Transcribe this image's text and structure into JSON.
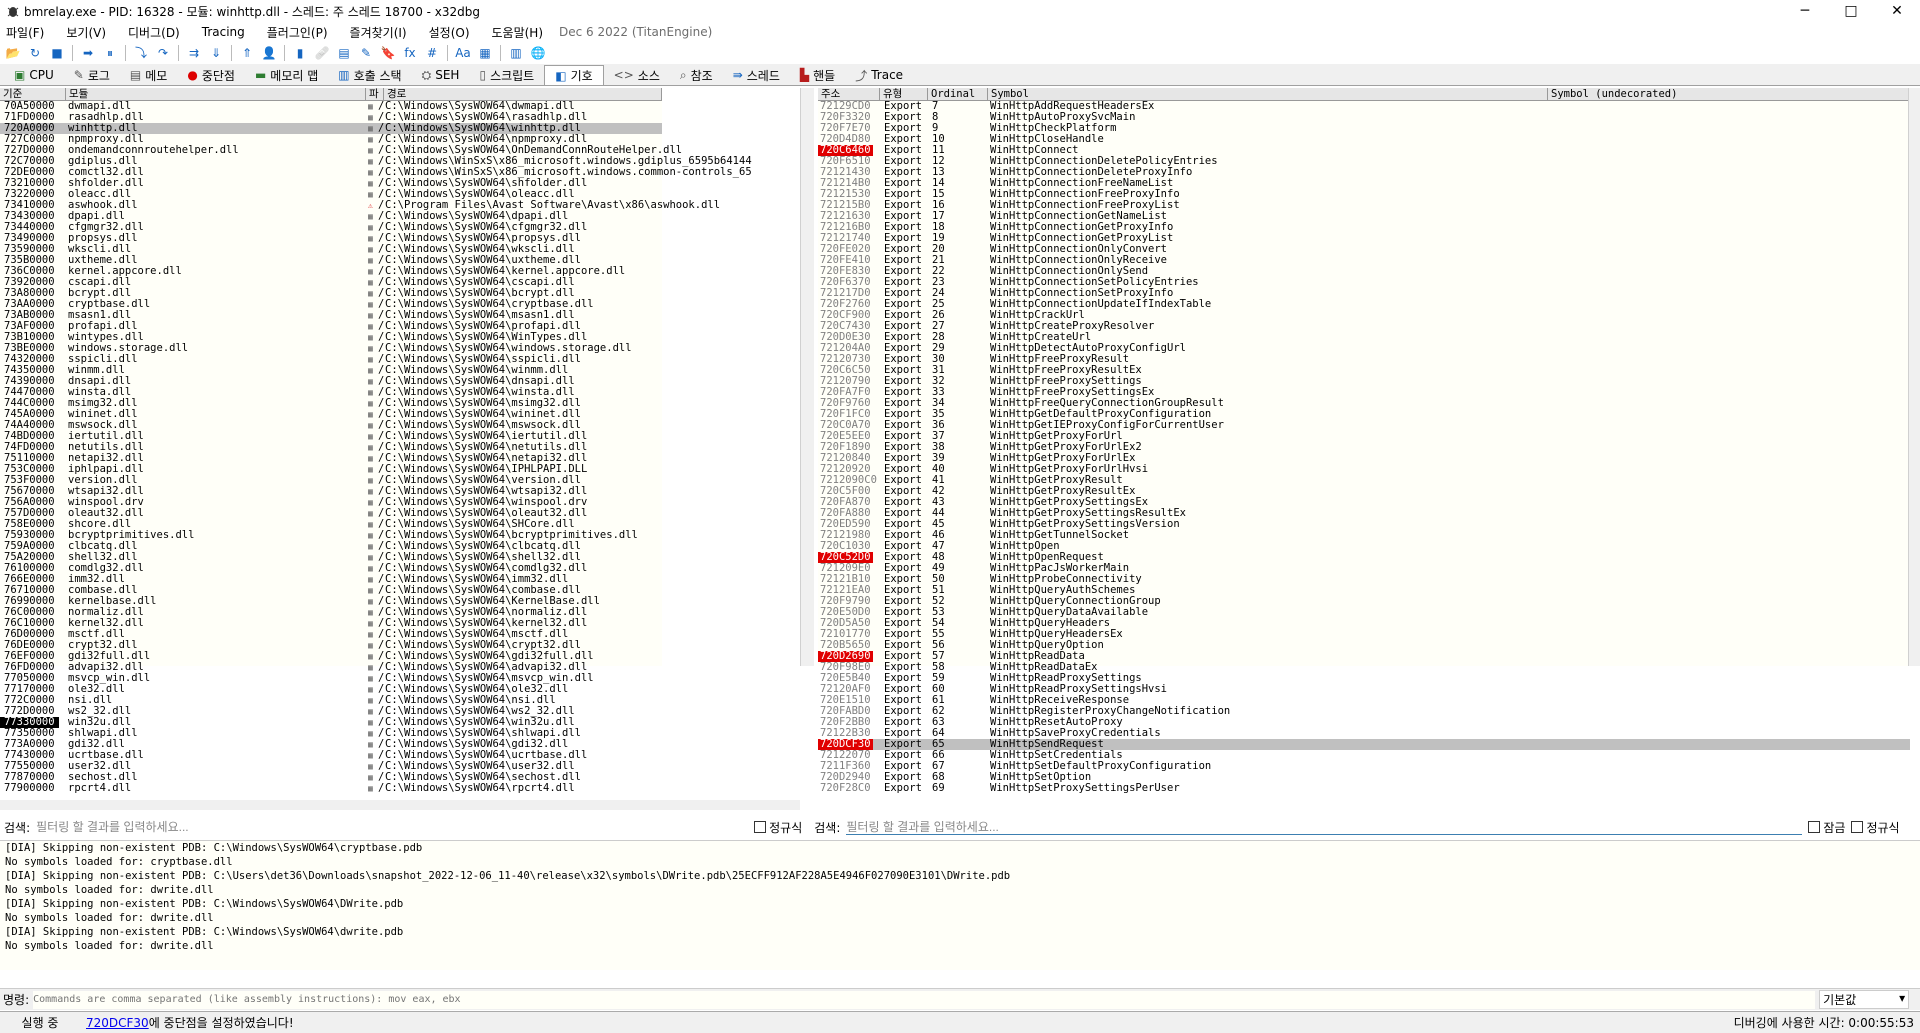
{
  "window": {
    "title": "bmrelay.exe - PID: 16328 - 모듈: winhttp.dll - 스레드: 주 스레드 18700 - x32dbg",
    "minimize": "─",
    "maximize": "□",
    "close": "✕"
  },
  "menu": {
    "items": [
      "파일(F)",
      "보기(V)",
      "디버그(D)",
      "Tracing",
      "플러그인(P)",
      "즐겨찾기(I)",
      "설정(O)",
      "도움말(H)"
    ],
    "build_date": "Dec 6 2022 (TitanEngine)"
  },
  "toolbar": {
    "icons": [
      {
        "name": "open-icon",
        "glyph": "📂"
      },
      {
        "name": "restart-icon",
        "glyph": "↻"
      },
      {
        "name": "close-icon",
        "glyph": "■"
      },
      {
        "sep": true
      },
      {
        "name": "run-icon",
        "glyph": "➡"
      },
      {
        "name": "pause-icon",
        "glyph": "⏸"
      },
      {
        "sep": true
      },
      {
        "name": "step-into-icon",
        "glyph": "⤵"
      },
      {
        "name": "step-over-icon",
        "glyph": "↷"
      },
      {
        "sep": true
      },
      {
        "name": "trace-into-icon",
        "glyph": "⇉"
      },
      {
        "name": "trace-over-icon",
        "glyph": "⇓"
      },
      {
        "sep": true
      },
      {
        "name": "execute-till-return-icon",
        "glyph": "⇑"
      },
      {
        "name": "run-to-user-icon",
        "glyph": "👤"
      },
      {
        "sep": true
      },
      {
        "name": "scylla-icon",
        "glyph": "▮"
      },
      {
        "name": "patch-icon",
        "glyph": "🩹"
      },
      {
        "name": "comments-icon",
        "glyph": "▤"
      },
      {
        "name": "labels-icon",
        "glyph": "✎"
      },
      {
        "name": "bookmarks-icon",
        "glyph": "🔖"
      },
      {
        "name": "functions-icon",
        "glyph": "fx"
      },
      {
        "name": "hash-icon",
        "glyph": "#"
      },
      {
        "sep": true
      },
      {
        "name": "font-icon",
        "glyph": "Aa"
      },
      {
        "name": "calculator-icon",
        "glyph": "▦"
      },
      {
        "sep": true
      },
      {
        "name": "notes-icon",
        "glyph": "▥"
      },
      {
        "name": "globe-icon",
        "glyph": "🌐"
      }
    ]
  },
  "tabs": [
    {
      "label": "CPU",
      "icon": "cpu-icon",
      "glyph": "▣",
      "color": "#2e7d32",
      "active": false
    },
    {
      "label": "로그",
      "icon": "log-icon",
      "glyph": "✎",
      "color": "#555",
      "active": false
    },
    {
      "label": "메모",
      "icon": "notes-icon",
      "glyph": "▤",
      "color": "#555",
      "active": false
    },
    {
      "label": "중단점",
      "icon": "breakpoint-icon",
      "glyph": "●",
      "color": "#d00",
      "active": false
    },
    {
      "label": "메모리 맵",
      "icon": "memory-map-icon",
      "glyph": "▬",
      "color": "#2e7d32",
      "active": false
    },
    {
      "label": "호출 스택",
      "icon": "call-stack-icon",
      "glyph": "▥",
      "color": "#1565c0",
      "active": false
    },
    {
      "label": "SEH",
      "icon": "seh-icon",
      "glyph": "⛭",
      "color": "#555",
      "active": false
    },
    {
      "label": "스크립트",
      "icon": "script-icon",
      "glyph": "▯",
      "color": "#555",
      "active": false
    },
    {
      "label": "기호",
      "icon": "symbols-icon",
      "glyph": "◧",
      "color": "#1565c0",
      "active": true
    },
    {
      "label": "소스",
      "icon": "source-icon",
      "glyph": "<>",
      "color": "#555",
      "active": false
    },
    {
      "label": "참조",
      "icon": "references-icon",
      "glyph": "⌕",
      "color": "#555",
      "active": false
    },
    {
      "label": "스레드",
      "icon": "threads-icon",
      "glyph": "⇛",
      "color": "#1565c0",
      "active": false
    },
    {
      "label": "핸들",
      "icon": "handles-icon",
      "glyph": "▙",
      "color": "#b71c1c",
      "active": false
    },
    {
      "label": "Trace",
      "icon": "trace-icon",
      "glyph": "⤴",
      "color": "#555",
      "active": false
    }
  ],
  "modules": {
    "headers": [
      "기준",
      "모듈",
      "파",
      "경로"
    ],
    "rows": [
      [
        "70A50000",
        "dwmapi.dll",
        "C:\\Windows\\SysWOW64\\dwmapi.dll"
      ],
      [
        "71FD0000",
        "rasadhlp.dll",
        "C:\\Windows\\SysWOW64\\rasadhlp.dll"
      ],
      [
        "720A0000",
        "winhttp.dll",
        "C:\\Windows\\SysWOW64\\winhttp.dll"
      ],
      [
        "727C0000",
        "npmproxy.dll",
        "C:\\Windows\\SysWOW64\\npmproxy.dll"
      ],
      [
        "727D0000",
        "ondemandconnroutehelper.dll",
        "C:\\Windows\\SysWOW64\\OnDemandConnRouteHelper.dll"
      ],
      [
        "72C70000",
        "gdiplus.dll",
        "C:\\Windows\\WinSxS\\x86_microsoft.windows.gdiplus_6595b64144"
      ],
      [
        "72DE0000",
        "comctl32.dll",
        "C:\\Windows\\WinSxS\\x86_microsoft.windows.common-controls_65"
      ],
      [
        "73210000",
        "shfolder.dll",
        "C:\\Windows\\SysWOW64\\shfolder.dll"
      ],
      [
        "73220000",
        "oleacc.dll",
        "C:\\Windows\\SysWOW64\\oleacc.dll"
      ],
      [
        "73410000",
        "aswhook.dll",
        "C:\\Program Files\\Avast Software\\Avast\\x86\\aswhook.dll"
      ],
      [
        "73430000",
        "dpapi.dll",
        "C:\\Windows\\SysWOW64\\dpapi.dll"
      ],
      [
        "73440000",
        "cfgmgr32.dll",
        "C:\\Windows\\SysWOW64\\cfgmgr32.dll"
      ],
      [
        "73490000",
        "propsys.dll",
        "C:\\Windows\\SysWOW64\\propsys.dll"
      ],
      [
        "73590000",
        "wkscli.dll",
        "C:\\Windows\\SysWOW64\\wkscli.dll"
      ],
      [
        "735B0000",
        "uxtheme.dll",
        "C:\\Windows\\SysWOW64\\uxtheme.dll"
      ],
      [
        "736C0000",
        "kernel.appcore.dll",
        "C:\\Windows\\SysWOW64\\kernel.appcore.dll"
      ],
      [
        "73920000",
        "cscapi.dll",
        "C:\\Windows\\SysWOW64\\cscapi.dll"
      ],
      [
        "73A80000",
        "bcrypt.dll",
        "C:\\Windows\\SysWOW64\\bcrypt.dll"
      ],
      [
        "73AA0000",
        "cryptbase.dll",
        "C:\\Windows\\SysWOW64\\cryptbase.dll"
      ],
      [
        "73AB0000",
        "msasn1.dll",
        "C:\\Windows\\SysWOW64\\msasn1.dll"
      ],
      [
        "73AF0000",
        "profapi.dll",
        "C:\\Windows\\SysWOW64\\profapi.dll"
      ],
      [
        "73B10000",
        "wintypes.dll",
        "C:\\Windows\\SysWOW64\\WinTypes.dll"
      ],
      [
        "73BE0000",
        "windows.storage.dll",
        "C:\\Windows\\SysWOW64\\windows.storage.dll"
      ],
      [
        "74320000",
        "sspicli.dll",
        "C:\\Windows\\SysWOW64\\sspicli.dll"
      ],
      [
        "74350000",
        "winmm.dll",
        "C:\\Windows\\SysWOW64\\winmm.dll"
      ],
      [
        "74390000",
        "dnsapi.dll",
        "C:\\Windows\\SysWOW64\\dnsapi.dll"
      ],
      [
        "74470000",
        "winsta.dll",
        "C:\\Windows\\SysWOW64\\winsta.dll"
      ],
      [
        "744C0000",
        "msimg32.dll",
        "C:\\Windows\\SysWOW64\\msimg32.dll"
      ],
      [
        "745A0000",
        "wininet.dll",
        "C:\\Windows\\SysWOW64\\wininet.dll"
      ],
      [
        "74A40000",
        "mswsock.dll",
        "C:\\Windows\\SysWOW64\\mswsock.dll"
      ],
      [
        "74BD0000",
        "iertutil.dll",
        "C:\\Windows\\SysWOW64\\iertutil.dll"
      ],
      [
        "74FD0000",
        "netutils.dll",
        "C:\\Windows\\SysWOW64\\netutils.dll"
      ],
      [
        "75110000",
        "netapi32.dll",
        "C:\\Windows\\SysWOW64\\netapi32.dll"
      ],
      [
        "753C0000",
        "iphlpapi.dll",
        "C:\\Windows\\SysWOW64\\IPHLPAPI.DLL"
      ],
      [
        "753F0000",
        "version.dll",
        "C:\\Windows\\SysWOW64\\version.dll"
      ],
      [
        "75670000",
        "wtsapi32.dll",
        "C:\\Windows\\SysWOW64\\wtsapi32.dll"
      ],
      [
        "756A0000",
        "winspool.drv",
        "C:\\Windows\\SysWOW64\\winspool.drv"
      ],
      [
        "757D0000",
        "oleaut32.dll",
        "C:\\Windows\\SysWOW64\\oleaut32.dll"
      ],
      [
        "758E0000",
        "shcore.dll",
        "C:\\Windows\\SysWOW64\\SHCore.dll"
      ],
      [
        "75930000",
        "bcryptprimitives.dll",
        "C:\\Windows\\SysWOW64\\bcryptprimitives.dll"
      ],
      [
        "759A0000",
        "clbcatq.dll",
        "C:\\Windows\\SysWOW64\\clbcatq.dll"
      ],
      [
        "75A20000",
        "shell32.dll",
        "C:\\Windows\\SysWOW64\\shell32.dll"
      ],
      [
        "76100000",
        "comdlg32.dll",
        "C:\\Windows\\SysWOW64\\comdlg32.dll"
      ],
      [
        "766E0000",
        "imm32.dll",
        "C:\\Windows\\SysWOW64\\imm32.dll"
      ],
      [
        "76710000",
        "combase.dll",
        "C:\\Windows\\SysWOW64\\combase.dll"
      ],
      [
        "76990000",
        "kernelbase.dll",
        "C:\\Windows\\SysWOW64\\KernelBase.dll"
      ],
      [
        "76C00000",
        "normaliz.dll",
        "C:\\Windows\\SysWOW64\\normaliz.dll"
      ],
      [
        "76C10000",
        "kernel32.dll",
        "C:\\Windows\\SysWOW64\\kernel32.dll"
      ],
      [
        "76D00000",
        "msctf.dll",
        "C:\\Windows\\SysWOW64\\msctf.dll"
      ],
      [
        "76DE0000",
        "crypt32.dll",
        "C:\\Windows\\SysWOW64\\crypt32.dll"
      ],
      [
        "76EF0000",
        "gdi32full.dll",
        "C:\\Windows\\SysWOW64\\gdi32full.dll"
      ],
      [
        "76FD0000",
        "advapi32.dll",
        "C:\\Windows\\SysWOW64\\advapi32.dll"
      ],
      [
        "77050000",
        "msvcp_win.dll",
        "C:\\Windows\\SysWOW64\\msvcp_win.dll"
      ],
      [
        "77170000",
        "ole32.dll",
        "C:\\Windows\\SysWOW64\\ole32.dll"
      ],
      [
        "772C0000",
        "nsi.dll",
        "C:\\Windows\\SysWOW64\\nsi.dll"
      ],
      [
        "772D0000",
        "ws2_32.dll",
        "C:\\Windows\\SysWOW64\\ws2_32.dll"
      ],
      [
        "77330000",
        "win32u.dll",
        "C:\\Windows\\SysWOW64\\win32u.dll"
      ],
      [
        "77350000",
        "shlwapi.dll",
        "C:\\Windows\\SysWOW64\\shlwapi.dll"
      ],
      [
        "773A0000",
        "gdi32.dll",
        "C:\\Windows\\SysWOW64\\gdi32.dll"
      ],
      [
        "77430000",
        "ucrtbase.dll",
        "C:\\Windows\\SysWOW64\\ucrtbase.dll"
      ],
      [
        "77550000",
        "user32.dll",
        "C:\\Windows\\SysWOW64\\user32.dll"
      ],
      [
        "77870000",
        "sechost.dll",
        "C:\\Windows\\SysWOW64\\sechost.dll"
      ],
      [
        "77900000",
        "rpcrt4.dll",
        "C:\\Windows\\SysWOW64\\rpcrt4.dll"
      ]
    ]
  },
  "symbols": {
    "headers": [
      "주소",
      "유형",
      "Ordinal",
      "Symbol",
      "Symbol (undecorated)"
    ],
    "rows": [
      [
        "72129CD0",
        "Export",
        "7",
        "WinHttpAddRequestHeadersEx"
      ],
      [
        "720F3320",
        "Export",
        "8",
        "WinHttpAutoProxySvcMain"
      ],
      [
        "720F7E70",
        "Export",
        "9",
        "WinHttpCheckPlatform"
      ],
      [
        "720D4D80",
        "Export",
        "10",
        "WinHttpCloseHandle"
      ],
      [
        "720C6460",
        "Export",
        "11",
        "WinHttpConnect"
      ],
      [
        "720F6510",
        "Export",
        "12",
        "WinHttpConnectionDeletePolicyEntries"
      ],
      [
        "72121430",
        "Export",
        "13",
        "WinHttpConnectionDeleteProxyInfo"
      ],
      [
        "721214B0",
        "Export",
        "14",
        "WinHttpConnectionFreeNameList"
      ],
      [
        "72121530",
        "Export",
        "15",
        "WinHttpConnectionFreeProxyInfo"
      ],
      [
        "721215B0",
        "Export",
        "16",
        "WinHttpConnectionFreeProxyList"
      ],
      [
        "72121630",
        "Export",
        "17",
        "WinHttpConnectionGetNameList"
      ],
      [
        "721216B0",
        "Export",
        "18",
        "WinHttpConnectionGetProxyInfo"
      ],
      [
        "72121740",
        "Export",
        "19",
        "WinHttpConnectionGetProxyList"
      ],
      [
        "720FE020",
        "Export",
        "20",
        "WinHttpConnectionOnlyConvert"
      ],
      [
        "720FE410",
        "Export",
        "21",
        "WinHttpConnectionOnlyReceive"
      ],
      [
        "720FE830",
        "Export",
        "22",
        "WinHttpConnectionOnlySend"
      ],
      [
        "720F6370",
        "Export",
        "23",
        "WinHttpConnectionSetPolicyEntries"
      ],
      [
        "721217D0",
        "Export",
        "24",
        "WinHttpConnectionSetProxyInfo"
      ],
      [
        "720F2760",
        "Export",
        "25",
        "WinHttpConnectionUpdateIfIndexTable"
      ],
      [
        "720CF900",
        "Export",
        "26",
        "WinHttpCrackUrl"
      ],
      [
        "720C7430",
        "Export",
        "27",
        "WinHttpCreateProxyResolver"
      ],
      [
        "720D0E30",
        "Export",
        "28",
        "WinHttpCreateUrl"
      ],
      [
        "721204A0",
        "Export",
        "29",
        "WinHttpDetectAutoProxyConfigUrl"
      ],
      [
        "72120730",
        "Export",
        "30",
        "WinHttpFreeProxyResult"
      ],
      [
        "720C6C50",
        "Export",
        "31",
        "WinHttpFreeProxyResultEx"
      ],
      [
        "72120790",
        "Export",
        "32",
        "WinHttpFreeProxySettings"
      ],
      [
        "720FA7F0",
        "Export",
        "33",
        "WinHttpFreeProxySettingsEx"
      ],
      [
        "720F9760",
        "Export",
        "34",
        "WinHttpFreeQueryConnectionGroupResult"
      ],
      [
        "720F1FC0",
        "Export",
        "35",
        "WinHttpGetDefaultProxyConfiguration"
      ],
      [
        "720C0A70",
        "Export",
        "36",
        "WinHttpGetIEProxyConfigForCurrentUser"
      ],
      [
        "720E5EE0",
        "Export",
        "37",
        "WinHttpGetProxyForUrl"
      ],
      [
        "720F1890",
        "Export",
        "38",
        "WinHttpGetProxyForUrlEx2"
      ],
      [
        "72120840",
        "Export",
        "39",
        "WinHttpGetProxyForUrlEx"
      ],
      [
        "72120920",
        "Export",
        "40",
        "WinHttpGetProxyForUrlHvsi"
      ],
      [
        "7212090C0",
        "Export",
        "41",
        "WinHttpGetProxyResult"
      ],
      [
        "720C5F00",
        "Export",
        "42",
        "WinHttpGetProxyResultEx"
      ],
      [
        "720FA870",
        "Export",
        "43",
        "WinHttpGetProxySettingsEx"
      ],
      [
        "720FA880",
        "Export",
        "44",
        "WinHttpGetProxySettingsResultEx"
      ],
      [
        "720ED590",
        "Export",
        "45",
        "WinHttpGetProxySettingsVersion"
      ],
      [
        "72121980",
        "Export",
        "46",
        "WinHttpGetTunnelSocket"
      ],
      [
        "720C1030",
        "Export",
        "47",
        "WinHttpOpen"
      ],
      [
        "720C52D0",
        "Export",
        "48",
        "WinHttpOpenRequest"
      ],
      [
        "721209E0",
        "Export",
        "49",
        "WinHttpPacJsWorkerMain"
      ],
      [
        "72121B10",
        "Export",
        "50",
        "WinHttpProbeConnectivity"
      ],
      [
        "72121EA0",
        "Export",
        "51",
        "WinHttpQueryAuthSchemes"
      ],
      [
        "720F9790",
        "Export",
        "52",
        "WinHttpQueryConnectionGroup"
      ],
      [
        "720E50D0",
        "Export",
        "53",
        "WinHttpQueryDataAvailable"
      ],
      [
        "720D5A50",
        "Export",
        "54",
        "WinHttpQueryHeaders"
      ],
      [
        "72101770",
        "Export",
        "55",
        "WinHttpQueryHeadersEx"
      ],
      [
        "720B5650",
        "Export",
        "56",
        "WinHttpQueryOption"
      ],
      [
        "720D2690",
        "Export",
        "57",
        "WinHttpReadData"
      ],
      [
        "720F98E0",
        "Export",
        "58",
        "WinHttpReadDataEx"
      ],
      [
        "720E5B40",
        "Export",
        "59",
        "WinHttpReadProxySettings"
      ],
      [
        "72120AF0",
        "Export",
        "60",
        "WinHttpReadProxySettingsHvsi"
      ],
      [
        "720E1510",
        "Export",
        "61",
        "WinHttpReceiveResponse"
      ],
      [
        "720FABD0",
        "Export",
        "62",
        "WinHttpRegisterProxyChangeNotification"
      ],
      [
        "720F2BB0",
        "Export",
        "63",
        "WinHttpResetAutoProxy"
      ],
      [
        "72122B30",
        "Export",
        "64",
        "WinHttpSaveProxyCredentials"
      ],
      [
        "720DCF30",
        "Export",
        "65",
        "WinHttpSendRequest"
      ],
      [
        "72122070",
        "Export",
        "66",
        "WinHttpSetCredentials"
      ],
      [
        "7211F360",
        "Export",
        "67",
        "WinHttpSetDefaultProxyConfiguration"
      ],
      [
        "720D2940",
        "Export",
        "68",
        "WinHttpSetOption"
      ],
      [
        "720F28C0",
        "Export",
        "69",
        "WinHttpSetProxySettingsPerUser"
      ]
    ]
  },
  "search": {
    "left_label": "검색:",
    "left_placeholder": "필터링 할 결과를 입력하세요...",
    "left_regex": "정규식",
    "right_label": "검색:",
    "right_placeholder": "필터링 할 결과를 입력하세요...",
    "right_lock": "잠금",
    "right_regex": "정규식"
  },
  "log": [
    "[DIA] Skipping non-existent PDB: C:\\Windows\\SysWOW64\\cryptbase.pdb",
    "No symbols loaded for: cryptbase.dll",
    "[DIA] Skipping non-existent PDB: C:\\Users\\det36\\Downloads\\snapshot_2022-12-06_11-40\\release\\x32\\symbols\\DWrite.pdb\\25ECFF912AF228A5E4946F027090E3101\\DWrite.pdb",
    "No symbols loaded for: dwrite.dll",
    "[DIA] Skipping non-existent PDB: C:\\Windows\\SysWOW64\\DWrite.pdb",
    "No symbols loaded for: dwrite.dll",
    "[DIA] Skipping non-existent PDB: C:\\Windows\\SysWOW64\\dwrite.pdb",
    "No symbols loaded for: dwrite.dll"
  ],
  "command": {
    "label": "명령:",
    "placeholder": "Commands are comma separated (like assembly instructions): mov eax, ebx",
    "mode": "기본값"
  },
  "status": {
    "state": "실행 중",
    "bp_addr": "720DCF30",
    "bp_msg": "에 중단점을 설정하였습니다!",
    "time": "디버깅에 사용한 시간: 0:00:55:53"
  },
  "colors": {
    "breakpoint_bg": "#e00000",
    "selection_bg": "#c0c0c0",
    "pane_bg": "#fffff8",
    "current_base_bg": "#000000"
  }
}
